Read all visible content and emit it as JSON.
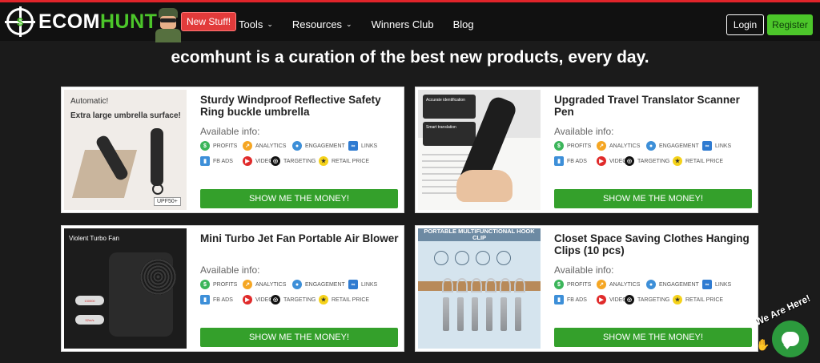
{
  "header": {
    "logo_part1": "ECOM",
    "logo_part2": "HUNT",
    "logo_symbol": "$",
    "new_badge": "New Stuff!",
    "nav": [
      {
        "label": "Tools",
        "has_dropdown": true
      },
      {
        "label": "Resources",
        "has_dropdown": true
      },
      {
        "label": "Winners Club",
        "has_dropdown": false
      },
      {
        "label": "Blog",
        "has_dropdown": false
      }
    ],
    "chevron": "⌄",
    "login_label": "Login",
    "register_label": "Register"
  },
  "headline": "ecomhunt is a curation of the best new products, every day.",
  "colors": {
    "accent_green": "#4cc62a",
    "button_green": "#34a02b",
    "badge_red": "#e23b3b",
    "background": "#1b1b1b"
  },
  "common": {
    "available_info_label": "Available info:",
    "cta_label": "SHOW ME THE MONEY!",
    "tags_row1": [
      {
        "label": "PROFITS",
        "icon": "dollar-icon",
        "glyph": "$",
        "color": "#3bb55a"
      },
      {
        "label": "ANALYTICS",
        "icon": "analytics-icon",
        "glyph": "↗",
        "color": "#f5a623"
      },
      {
        "label": "ENGAGEMENT",
        "icon": "engagement-icon",
        "glyph": "●",
        "color": "#3d8fd8"
      },
      {
        "label": "LINKS",
        "icon": "link-icon",
        "glyph": "∞",
        "color": "#2f7bd1"
      }
    ],
    "tags_row2": [
      {
        "label": "FB ADS",
        "icon": "fb-ads-icon",
        "glyph": "▮",
        "color": "#3d8fd8"
      },
      {
        "label": "VIDEO",
        "icon": "video-icon",
        "glyph": "▶",
        "color": "#e02b2b"
      },
      {
        "label": "TARGETING",
        "icon": "targeting-icon",
        "glyph": "◎",
        "color": "#111111"
      },
      {
        "label": "RETAIL PRICE",
        "icon": "price-tag-icon",
        "glyph": "★",
        "color": "#f5d21a"
      }
    ]
  },
  "products": [
    {
      "title": "Sturdy Windproof Reflective Safety Ring buckle umbrella",
      "image_text": [
        "Automatic!",
        "Extra large umbrella surface!",
        "UPF50+"
      ]
    },
    {
      "title": "Upgraded Travel Translator Scanner Pen",
      "image_text": [
        "Accurate identification",
        "Smart translation"
      ]
    },
    {
      "title": "Mini Turbo Jet Fan Portable Air Blower",
      "image_text": [
        "Violent Turbo Fan",
        "130000",
        "52m/s"
      ]
    },
    {
      "title": "Closet Space Saving Clothes Hanging Clips (10 pcs)",
      "image_text": [
        "PORTABLE MULTIFUNCTIONAL HOOK CLIP"
      ]
    }
  ],
  "chat": {
    "label": "We Are Here!",
    "wave": "✋"
  }
}
